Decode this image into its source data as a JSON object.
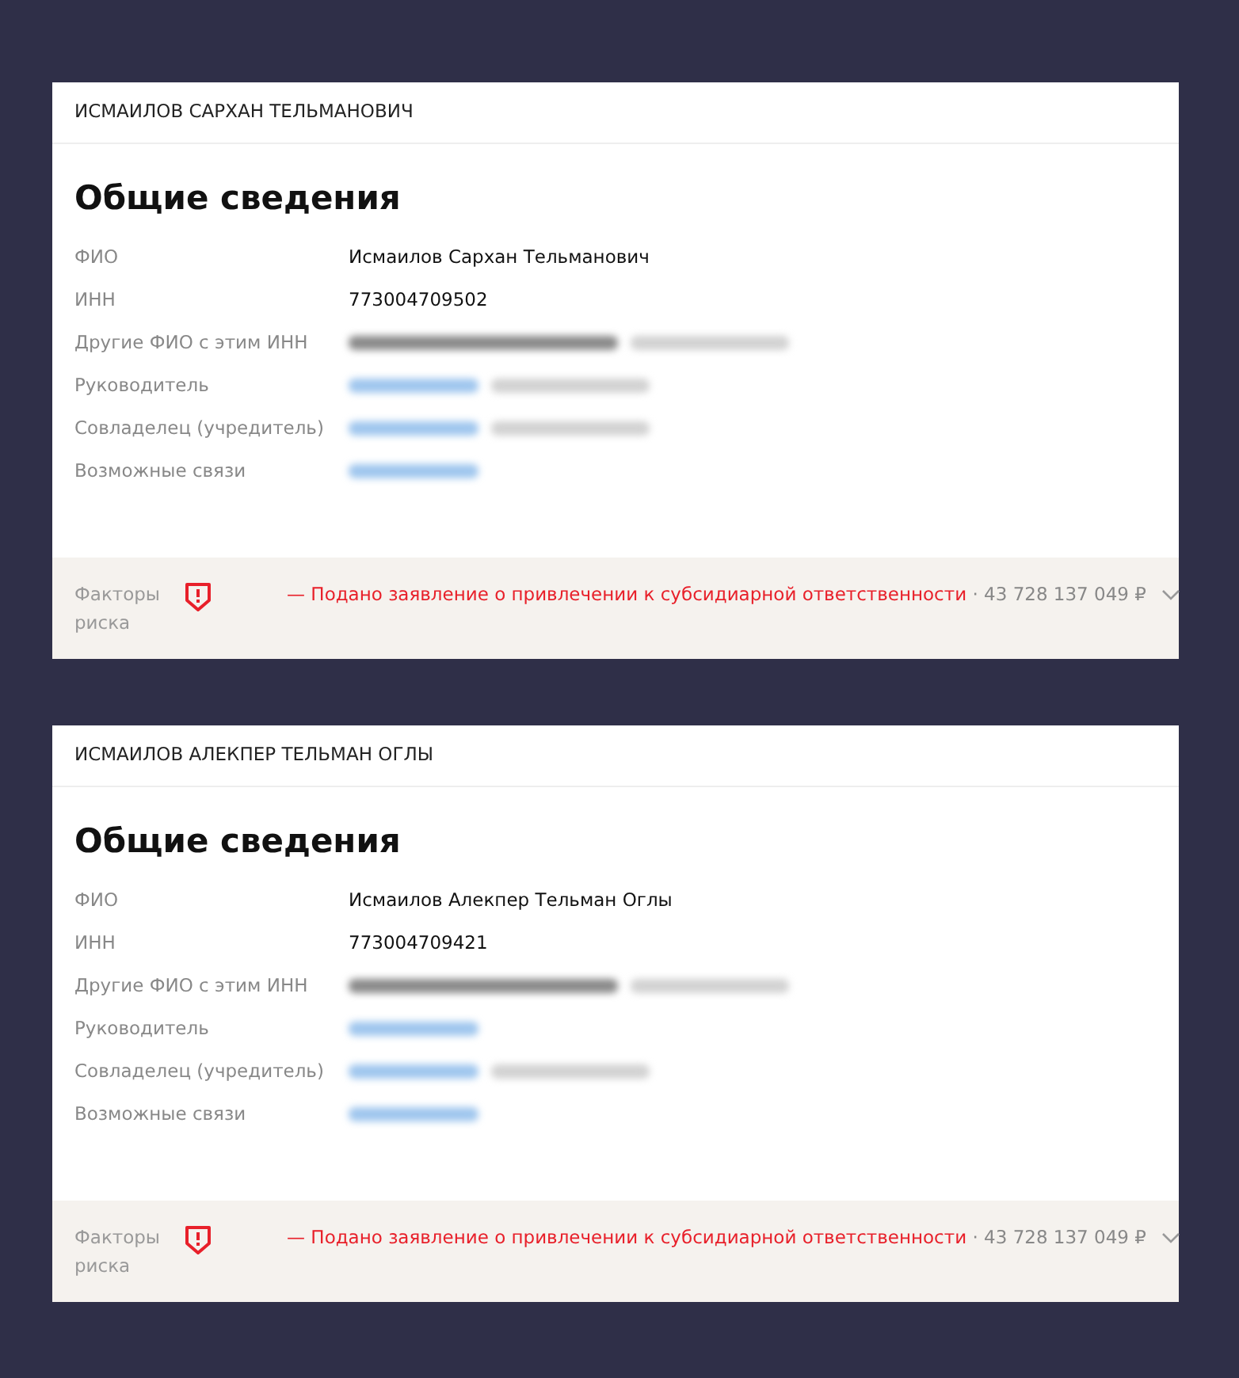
{
  "cards": [
    {
      "header": "ИСМАИЛОВ САРХАН ТЕЛЬМАНОВИЧ",
      "title": "Общие сведения",
      "rows": [
        {
          "label": "ФИО",
          "kind": "text",
          "value": "Исмаилов Сархан Тельманович"
        },
        {
          "label": "ИНН",
          "kind": "text",
          "value": "773004709502"
        },
        {
          "label": "Другие ФИО с этим ИНН",
          "kind": "blurred",
          "parts": [
            {
              "kind": "dark"
            },
            {
              "kind": "muted"
            }
          ]
        },
        {
          "label": "Руководитель",
          "kind": "blurred",
          "parts": [
            {
              "kind": "link"
            },
            {
              "kind": "muted"
            }
          ]
        },
        {
          "label": "Совладелец (учредитель)",
          "kind": "blurred",
          "parts": [
            {
              "kind": "link"
            },
            {
              "kind": "muted"
            }
          ]
        },
        {
          "label": "Возможные связи",
          "kind": "blurred",
          "parts": [
            {
              "kind": "link"
            }
          ]
        }
      ],
      "risk": {
        "label": "Факторы риска",
        "dash": "—",
        "text": "Подано заявление о привлечении к субсидиарной ответственности",
        "amount": "· 43 728 137 049 ₽",
        "expanded": false
      }
    },
    {
      "header": "ИСМАИЛОВ АЛЕКПЕР ТЕЛЬМАН ОГЛЫ",
      "title": "Общие сведения",
      "rows": [
        {
          "label": "ФИО",
          "kind": "text",
          "value": "Исмаилов Алекпер Тельман Оглы"
        },
        {
          "label": "ИНН",
          "kind": "text",
          "value": "773004709421"
        },
        {
          "label": "Другие ФИО с этим ИНН",
          "kind": "blurred",
          "parts": [
            {
              "kind": "dark"
            },
            {
              "kind": "muted"
            }
          ]
        },
        {
          "label": "Руководитель",
          "kind": "blurred",
          "parts": [
            {
              "kind": "link"
            }
          ]
        },
        {
          "label": "Совладелец (учредитель)",
          "kind": "blurred",
          "parts": [
            {
              "kind": "link"
            },
            {
              "kind": "muted"
            }
          ]
        },
        {
          "label": "Возможные связи",
          "kind": "blurred",
          "parts": [
            {
              "kind": "link"
            }
          ]
        }
      ],
      "risk": {
        "label": "Факторы риска",
        "dash": "—",
        "text": "Подано заявление о привлечении к субсидиарной ответственности",
        "amount": "· 43 728 137 049 ₽",
        "expanded": false
      }
    }
  ]
}
